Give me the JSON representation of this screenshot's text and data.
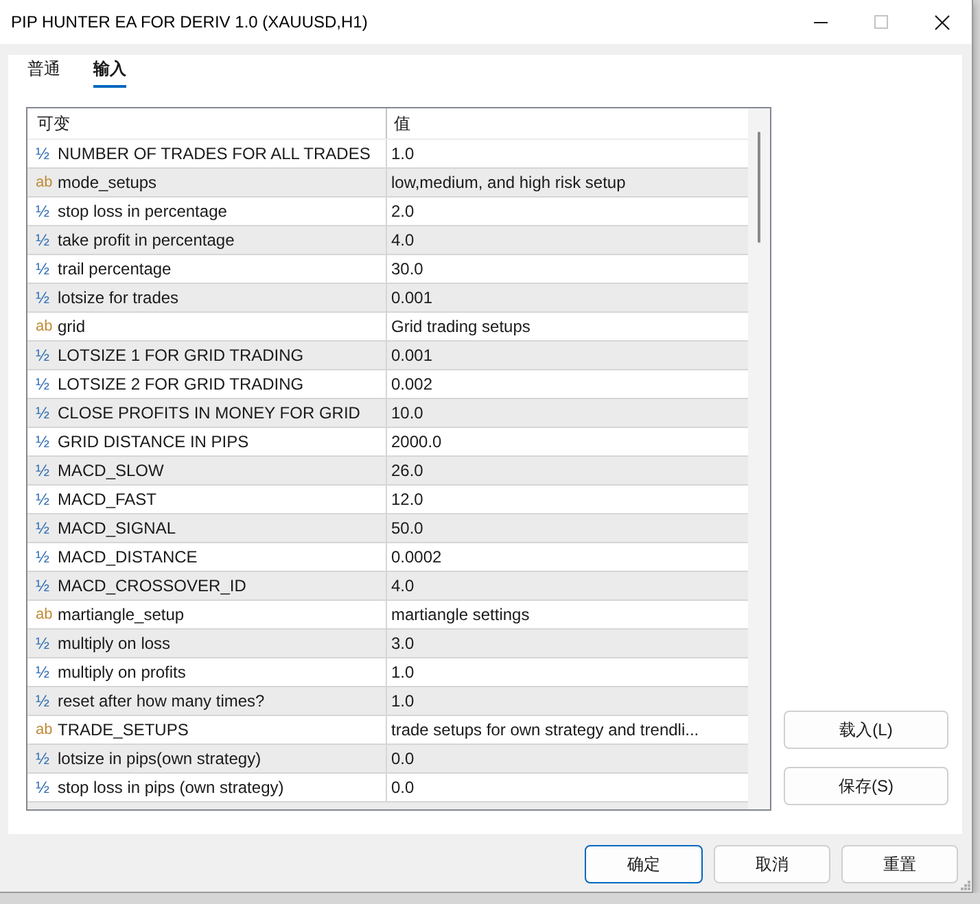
{
  "window": {
    "title": "PIP HUNTER EA FOR DERIV 1.0 (XAUUSD,H1)"
  },
  "title_bar_buttons": [
    {
      "kind": "minimize",
      "disabled": false
    },
    {
      "kind": "maximize",
      "disabled": true
    },
    {
      "kind": "close",
      "disabled": false
    }
  ],
  "tabs": [
    {
      "label": "普通",
      "selected": false
    },
    {
      "label": "输入",
      "selected": true
    }
  ],
  "table": {
    "columns": [
      "可变",
      "值"
    ],
    "rows": [
      {
        "kind": "number",
        "icon": "½",
        "name": "NUMBER OF TRADES FOR ALL TRADES",
        "value": "1.0"
      },
      {
        "kind": "text",
        "icon": "ab",
        "name": "mode_setups",
        "value": "low,medium, and high risk setup"
      },
      {
        "kind": "number",
        "icon": "½",
        "name": "stop loss in percentage",
        "value": "2.0"
      },
      {
        "kind": "number",
        "icon": "½",
        "name": "take profit in percentage",
        "value": "4.0"
      },
      {
        "kind": "number",
        "icon": "½",
        "name": "trail percentage",
        "value": "30.0"
      },
      {
        "kind": "number",
        "icon": "½",
        "name": "lotsize for trades",
        "value": "0.001"
      },
      {
        "kind": "text",
        "icon": "ab",
        "name": "grid",
        "value": "Grid trading setups"
      },
      {
        "kind": "number",
        "icon": "½",
        "name": "LOTSIZE 1 FOR GRID TRADING",
        "value": "0.001"
      },
      {
        "kind": "number",
        "icon": "½",
        "name": "LOTSIZE 2 FOR GRID TRADING",
        "value": "0.002"
      },
      {
        "kind": "number",
        "icon": "½",
        "name": "CLOSE PROFITS IN MONEY FOR GRID",
        "value": "10.0"
      },
      {
        "kind": "number",
        "icon": "½",
        "name": "GRID DISTANCE IN PIPS",
        "value": "2000.0"
      },
      {
        "kind": "number",
        "icon": "½",
        "name": "MACD_SLOW",
        "value": "26.0"
      },
      {
        "kind": "number",
        "icon": "½",
        "name": "MACD_FAST",
        "value": "12.0"
      },
      {
        "kind": "number",
        "icon": "½",
        "name": "MACD_SIGNAL",
        "value": "50.0"
      },
      {
        "kind": "number",
        "icon": "½",
        "name": "MACD_DISTANCE",
        "value": "0.0002"
      },
      {
        "kind": "number",
        "icon": "½",
        "name": "MACD_CROSSOVER_ID",
        "value": "4.0"
      },
      {
        "kind": "text",
        "icon": "ab",
        "name": "martiangle_setup",
        "value": "martiangle settings"
      },
      {
        "kind": "number",
        "icon": "½",
        "name": "multiply on loss",
        "value": "3.0"
      },
      {
        "kind": "number",
        "icon": "½",
        "name": "multiply on profits",
        "value": "1.0"
      },
      {
        "kind": "number",
        "icon": "½",
        "name": "reset after how many times?",
        "value": "1.0"
      },
      {
        "kind": "text",
        "icon": "ab",
        "name": "TRADE_SETUPS",
        "value": "trade setups for own strategy and trendli..."
      },
      {
        "kind": "number",
        "icon": "½",
        "name": "lotsize in pips(own strategy)",
        "value": "0.0"
      },
      {
        "kind": "number",
        "icon": "½",
        "name": "stop loss in pips (own strategy)",
        "value": "0.0"
      }
    ]
  },
  "side_buttons": [
    "载入(L)",
    "保存(S)"
  ],
  "buttons": [
    {
      "label": "确定",
      "default": true
    },
    {
      "label": "取消",
      "default": false
    },
    {
      "label": "重置",
      "default": false
    }
  ]
}
